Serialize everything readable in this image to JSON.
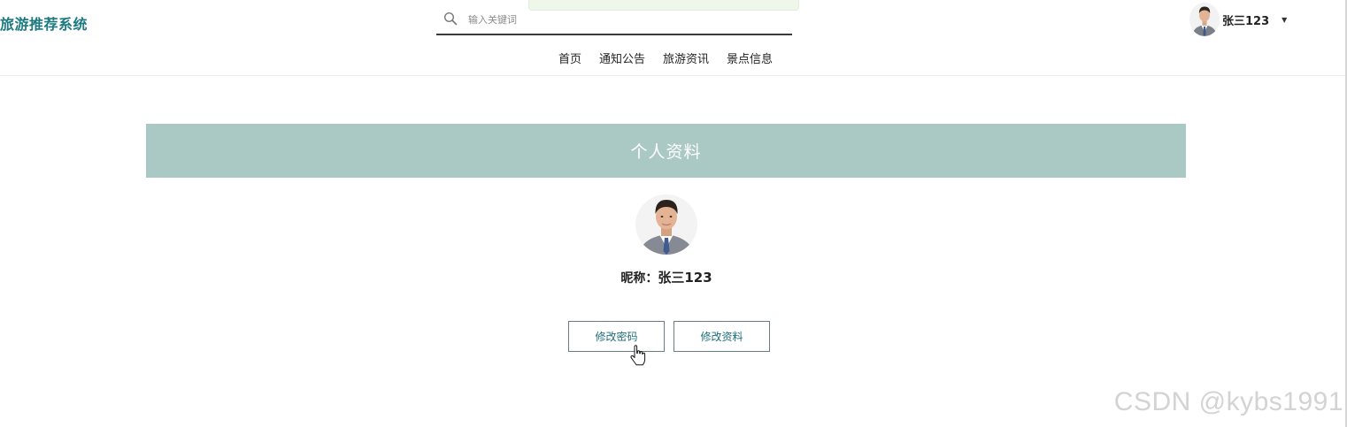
{
  "header": {
    "brand": "旅游推荐系统",
    "search": {
      "placeholder": "输入关键词",
      "value": ""
    },
    "nav": [
      {
        "label": "首页"
      },
      {
        "label": "通知公告"
      },
      {
        "label": "旅游资讯"
      },
      {
        "label": "景点信息"
      }
    ],
    "user": {
      "name": "张三123",
      "icon": "caret-down-icon"
    }
  },
  "profile": {
    "title": "个人资料",
    "nickname_label": "昵称：",
    "nickname_value": "张三123",
    "buttons": {
      "change_password": "修改密码",
      "edit_profile": "修改资料"
    }
  },
  "watermark": "CSDN @kybs1991",
  "colors": {
    "brand": "#1d7a80",
    "banner": "#abc9c4",
    "button_text": "#1f6f79",
    "toast": "#eef7ea"
  }
}
